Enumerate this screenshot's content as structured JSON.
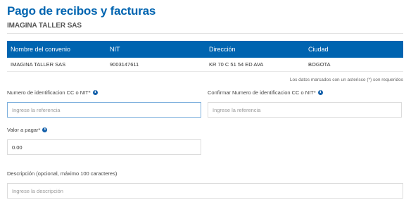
{
  "page": {
    "title": "Pago de recibos y facturas",
    "company": "IMAGINA TALLER SAS"
  },
  "table": {
    "headers": [
      "Nombre del convenio",
      "NIT",
      "Dirección",
      "Ciudad"
    ],
    "row": [
      "IMAGINA TALLER SAS",
      "9003147611",
      "KR 70 C 51 54 ED AVA",
      "BOGOTA"
    ]
  },
  "form": {
    "required_note": "Los datos marcados con un asterisco (*) son requeridos",
    "id_label": "Numero de identificacion CC o NIT*",
    "id_placeholder": "Ingrese la referencia",
    "confirm_label": "Confirmar Numero de identificacion CC o NIT*",
    "confirm_placeholder": "Ingrese la referencia",
    "amount_label": "Valor a pagar*",
    "amount_value": "0.00",
    "description_label": "Descripción (opcional, máximo 100 caracteres)",
    "description_placeholder": "Ingrese la descripción"
  },
  "icons": {
    "info": "info-icon"
  },
  "colors": {
    "brand": "#0064b0",
    "focus_border": "#7fb1dd"
  }
}
